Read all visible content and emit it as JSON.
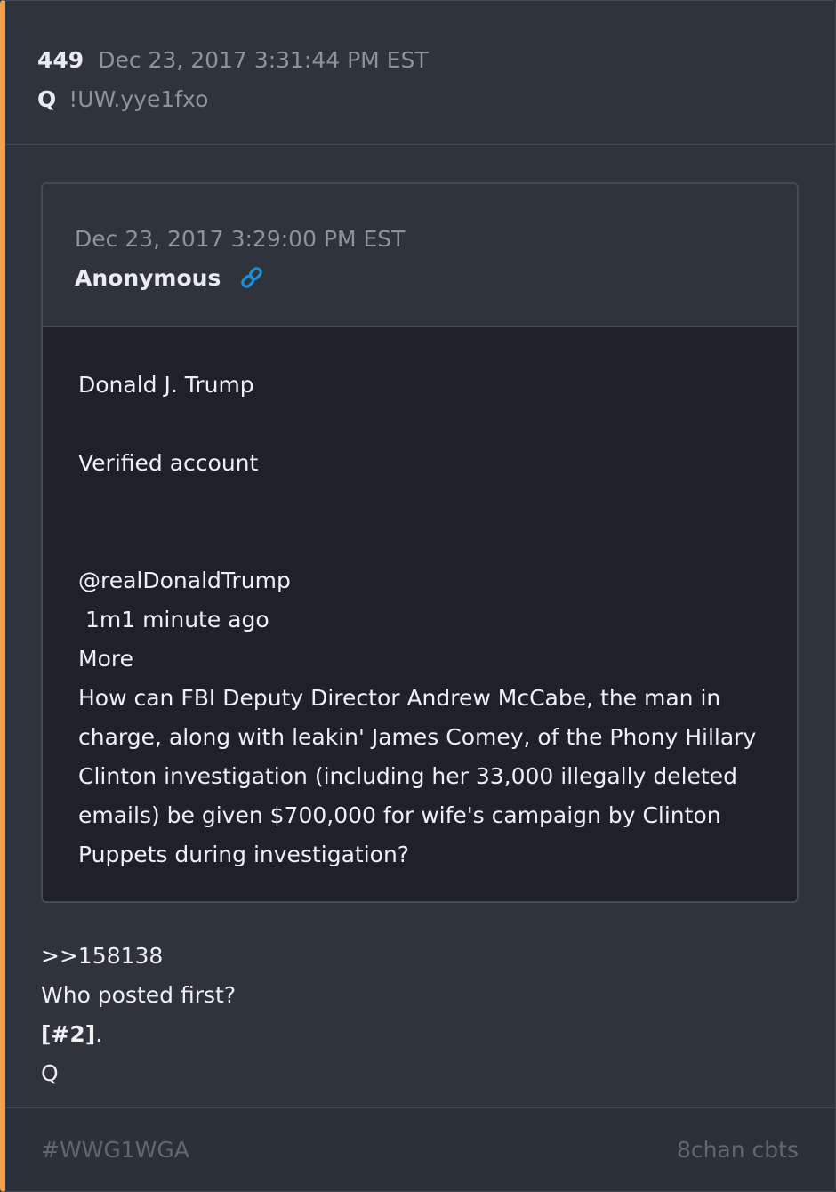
{
  "header": {
    "post_number": "449",
    "timestamp": "Dec 23, 2017 3:31:44 PM EST",
    "author": "Q",
    "tripcode": "!UW.yye1fxo"
  },
  "quoted_post": {
    "timestamp": "Dec 23, 2017 3:29:00 PM EST",
    "author": "Anonymous",
    "link_icon": "link-icon",
    "lines": [
      "Donald J. Trump",
      "",
      "Verified account",
      "",
      "",
      "@realDonaldTrump",
      " 1m1 minute ago",
      "More",
      "How can FBI Deputy Director Andrew McCabe, the man in",
      "charge, along with leakin' James Comey, of the Phony Hillary",
      "Clinton investigation (including her 33,000 illegally deleted",
      "emails) be given $700,000 for wife's campaign by Clinton",
      "Puppets during investigation?"
    ]
  },
  "message": {
    "reply_ref": ">>158138",
    "line2": "Who posted first?",
    "line3_bold": "[#2]",
    "line3_rest": ".",
    "line4": "Q"
  },
  "footer": {
    "tag": "#WWG1WGA",
    "source": "8chan cbts"
  },
  "colors": {
    "accent_border": "#f5a04a",
    "link_icon": "#1e8fd6",
    "background": "#2e333c",
    "quote_body_background": "#1e2127"
  }
}
